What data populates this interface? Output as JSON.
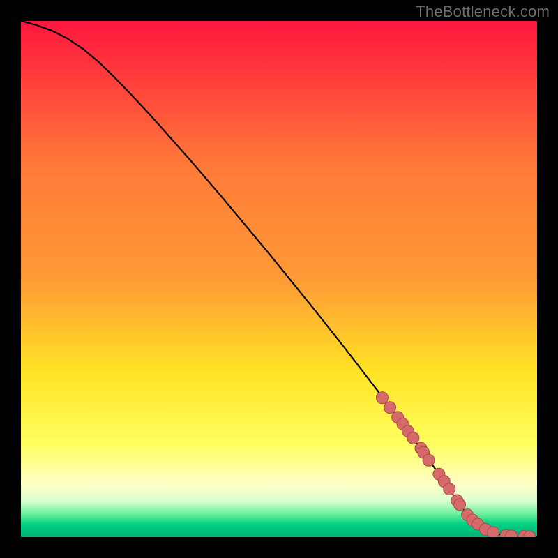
{
  "attribution": "TheBottleneck.com",
  "colors": {
    "curve": "#000000",
    "marker_fill": "#d66a6a",
    "marker_stroke": "#a94b4b",
    "gradient_top": "#ff163f",
    "gradient_mid_upper": "#ff9a36",
    "gradient_mid": "#ffe324",
    "gradient_mid_lower": "#ffff60",
    "gradient_lower": "#fdffc8",
    "gradient_green1": "#6cf09a",
    "gradient_green2": "#00d184",
    "gradient_bottom": "#00b176"
  },
  "chart_data": {
    "type": "line",
    "title": "",
    "xlabel": "",
    "ylabel": "",
    "xlim": [
      0,
      100
    ],
    "ylim": [
      0,
      100
    ],
    "series": [
      {
        "name": "curve",
        "x": [
          0,
          3,
          6,
          9,
          12,
          15,
          18,
          21,
          24,
          27,
          30,
          33,
          36,
          39,
          42,
          45,
          48,
          51,
          54,
          57,
          60,
          63,
          66,
          69,
          72,
          75,
          78,
          81,
          84,
          86,
          88,
          90,
          92,
          94,
          96,
          98,
          100
        ],
        "y": [
          100,
          99.2,
          98.1,
          96.6,
          94.6,
          92.1,
          89.2,
          86.1,
          82.9,
          79.6,
          76.2,
          72.8,
          69.3,
          65.8,
          62.2,
          58.6,
          55.0,
          51.3,
          47.6,
          43.9,
          40.1,
          36.3,
          32.4,
          28.5,
          24.5,
          20.5,
          16.4,
          12.2,
          7.8,
          5.0,
          3.0,
          1.5,
          0.7,
          0.3,
          0.15,
          0.08,
          0.05
        ]
      }
    ],
    "markers": {
      "name": "data-points",
      "x": [
        70,
        71.5,
        73,
        74,
        75,
        76,
        77.5,
        78,
        79,
        81,
        82,
        83,
        84.5,
        85,
        86.5,
        87.5,
        88.5,
        90,
        91.5,
        94,
        95,
        97.5,
        98.5
      ],
      "y": [
        27.0,
        25.1,
        23.2,
        21.9,
        20.5,
        19.2,
        17.2,
        16.4,
        14.9,
        12.2,
        10.8,
        9.3,
        7.1,
        6.3,
        4.3,
        3.3,
        2.5,
        1.5,
        0.9,
        0.3,
        0.2,
        0.1,
        0.07
      ]
    }
  }
}
